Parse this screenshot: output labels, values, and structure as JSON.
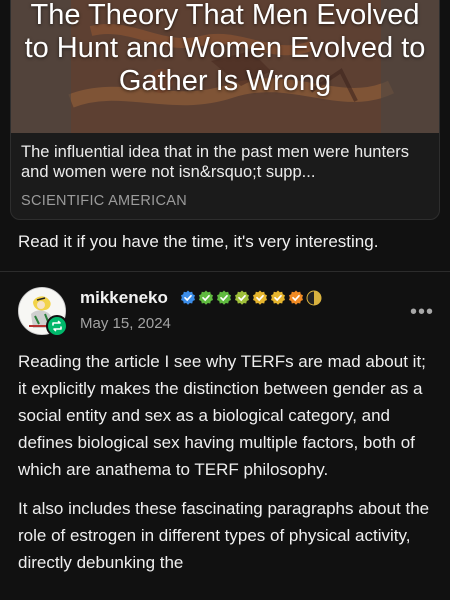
{
  "link_card": {
    "headline": "The Theory That Men Evolved to Hunt and Women Evolved to Gather Is Wrong",
    "description": "The influential idea that in the past men were hunters and women were not isn&rsquo;t supp...",
    "source": "SCIENTIFIC AMERICAN"
  },
  "caption": "Read it if you have the time, it's very interesting.",
  "reblog": {
    "username": "mikkeneko",
    "date": "May 15, 2024",
    "more_label": "•••",
    "badge_colors": [
      "#3c8de8",
      "#5fba3f",
      "#5fba3f",
      "#9fbf3a",
      "#e6b52e",
      "#e6b52e",
      "#f08a24",
      "#d9b23f"
    ]
  },
  "post": {
    "paragraphs": [
      "Reading the article I see why TERFs are mad about it; it explicitly makes the distinction between gender as a social entity and sex as a biological category, and defines biological sex having multiple factors, both of which are anathema to TERF philosophy.",
      "It also includes these fascinating paragraphs about the role of estrogen in different types of physical activity, directly debunking the"
    ]
  }
}
